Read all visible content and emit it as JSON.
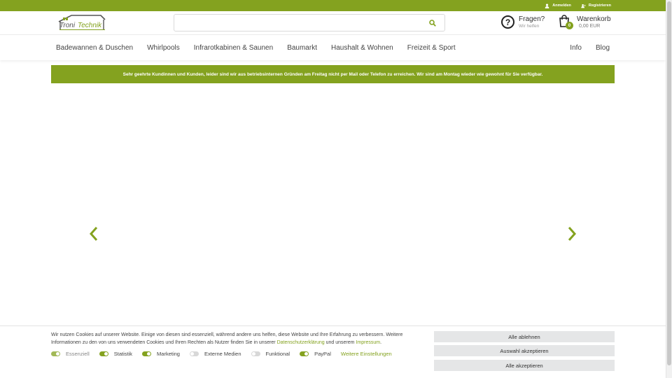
{
  "topbar": {
    "login": "Anmelden",
    "register": "Registrieren"
  },
  "header": {
    "logo_text": "TroniTechnik",
    "search_placeholder": "",
    "help_title": "Fragen?",
    "help_sub": "Wir helfen",
    "cart_title": "Warenkorb",
    "cart_total": "0,00 EUR",
    "cart_count": "0"
  },
  "nav": {
    "items": [
      "Badewannen & Duschen",
      "Whirlpools",
      "Infrarotkabinen & Saunen",
      "Baumarkt",
      "Haushalt & Wohnen",
      "Freizeit & Sport"
    ],
    "right": [
      "Info",
      "Blog"
    ]
  },
  "notice": "Sehr geehrte Kundinnen und Kunden, leider sind wir aus betriebsinternen Gründen am Freitag nicht per Mail oder Telefon zu erreichen. Wir sind am Montag wieder wie gewohnt für Sie verfügbar.",
  "cookie": {
    "text_part1": "Wir nutzen Cookies auf unserer Website. Einige von diesen sind essenziell, während andere uns helfen, diese Website und Ihre Erfahrung zu verbessern. Weitere Informationen zu den von uns verwendeten Cookies und Ihren Rechten als Nutzer finden Sie in unserer ",
    "privacy_link": "Datenschutzerklärung",
    "text_part2": " und unserem ",
    "imprint_link": "Impressum",
    "text_part3": ".",
    "toggles": [
      {
        "label": "Essenziell",
        "state": "on",
        "disabled": true
      },
      {
        "label": "Statistik",
        "state": "on",
        "disabled": false
      },
      {
        "label": "Marketing",
        "state": "on",
        "disabled": false
      },
      {
        "label": "Externe Medien",
        "state": "off",
        "disabled": false
      },
      {
        "label": "Funktional",
        "state": "off",
        "disabled": false
      },
      {
        "label": "PayPal",
        "state": "on",
        "disabled": false
      }
    ],
    "more_settings": "Weitere Einstellungen",
    "btn_reject": "Alle ablehnen",
    "btn_selection": "Auswahl akzeptieren",
    "btn_accept": "Alle akzeptieren"
  },
  "colors": {
    "accent": "#84a21f"
  }
}
